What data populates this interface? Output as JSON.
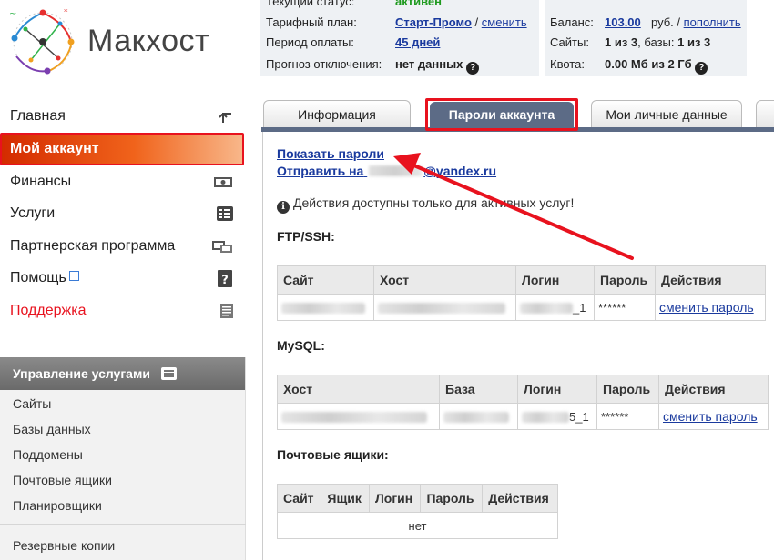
{
  "brand": {
    "name": "Макхост"
  },
  "header": {
    "status_label": "Текущий статус:",
    "status_value": "активен",
    "plan_label": "Тарифный план:",
    "plan_value": "Старт-Промо",
    "plan_sep": "/",
    "plan_change": "сменить",
    "period_label": "Период оплаты:",
    "period_value": "45 дней",
    "forecast_label": "Прогноз отключения:",
    "forecast_value": "нет данных",
    "balance_label": "Баланс:",
    "balance_value": "103.00",
    "balance_currency": "руб. /",
    "balance_topup": "пополнить",
    "sites_label": "Сайты:",
    "sites_value": "1 из 3",
    "db_label": ", базы:",
    "db_value": "1 из 3",
    "quota_label": "Квота:",
    "quota_value": "0.00 Мб из 2 Гб"
  },
  "sidebar": {
    "items": [
      {
        "label": "Главная",
        "icon": "arrow-up-icon"
      },
      {
        "label": "Мой аккаунт",
        "icon": ""
      },
      {
        "label": "Финансы",
        "icon": "money-icon"
      },
      {
        "label": "Услуги",
        "icon": "list-icon"
      },
      {
        "label": "Партнерская программа",
        "icon": "partner-icon"
      },
      {
        "label": "Помощь",
        "icon": "help-icon"
      },
      {
        "label": "Поддержка",
        "icon": "support-icon"
      }
    ],
    "services": {
      "title": "Управление услугами",
      "items": [
        "Сайты",
        "Базы данных",
        "Поддомены",
        "Почтовые ящики",
        "Планировщики",
        "Резервные копии"
      ]
    }
  },
  "tabs": [
    {
      "label": "Информация"
    },
    {
      "label": "Пароли аккаунта"
    },
    {
      "label": "Мои личные данные"
    }
  ],
  "main": {
    "show_passwords": "Показать пароли",
    "send_to_prefix": "Отправить на",
    "send_to_suffix": "@yandex.ru",
    "notice": "Действия доступны только для активных услуг!",
    "ftp": {
      "title": "FTP/SSH:",
      "headers": [
        "Сайт",
        "Хост",
        "Логин",
        "Пароль",
        "Действия"
      ],
      "row": {
        "login_suffix": "_1",
        "password": "******",
        "action": "сменить пароль"
      }
    },
    "mysql": {
      "title": "MySQL:",
      "headers": [
        "Хост",
        "База",
        "Логин",
        "Пароль",
        "Действия"
      ],
      "row": {
        "login_suffix": "5_1",
        "password": "******",
        "action": "сменить пароль"
      }
    },
    "mail": {
      "title": "Почтовые ящики:",
      "headers": [
        "Сайт",
        "Ящик",
        "Логин",
        "Пароль",
        "Действия"
      ],
      "empty": "нет"
    }
  },
  "colors": {
    "accent": "#e8121e",
    "tab_active": "#5c6b86",
    "link": "#1a3a9e",
    "status_ok": "#1e9a1e"
  }
}
